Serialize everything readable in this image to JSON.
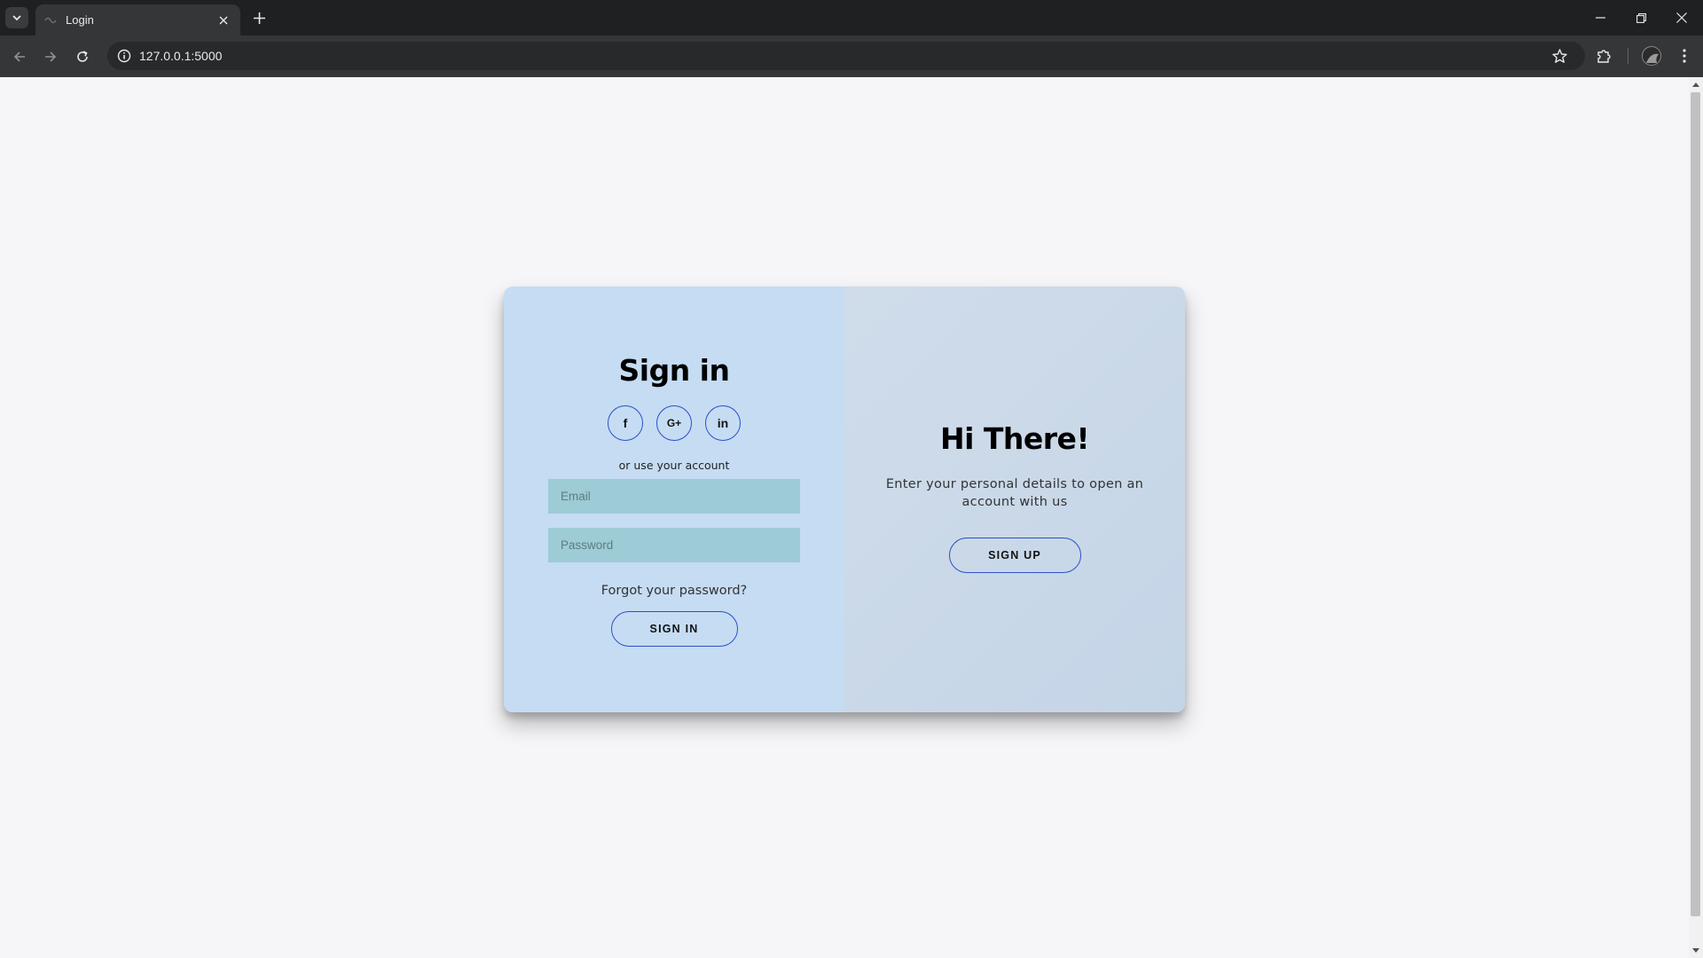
{
  "browser": {
    "tab_title": "Login",
    "url": "127.0.0.1:5000"
  },
  "signin": {
    "title": "Sign in",
    "social": [
      {
        "icon": "facebook-icon",
        "label": "f"
      },
      {
        "icon": "google-plus-icon",
        "label": "G+"
      },
      {
        "icon": "linkedin-icon",
        "label": "in"
      }
    ],
    "alt_text": "or use your account",
    "email_placeholder": "Email",
    "email_value": "",
    "password_placeholder": "Password",
    "password_value": "",
    "forgot_label": "Forgot your password?",
    "button_label": "SIGN IN"
  },
  "signup": {
    "title": "Hi There!",
    "text": "Enter your personal details to open an account with us",
    "button_label": "SIGN UP"
  },
  "colors": {
    "left_panel": "#c5dcf3",
    "right_panel": "#c9d8e8",
    "input_bg": "#9dcbd6",
    "accent_border": "#2a50c6"
  }
}
